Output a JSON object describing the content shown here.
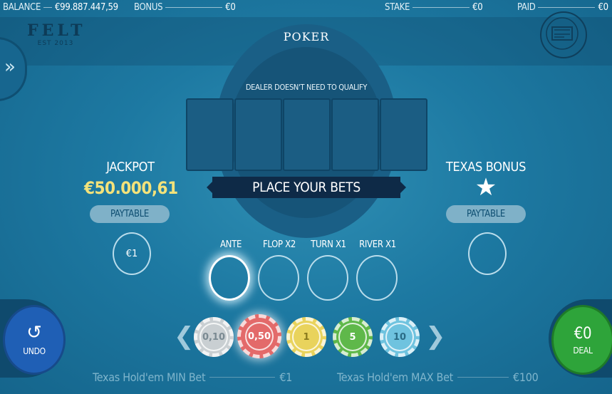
{
  "header": {
    "balance_label": "BALANCE",
    "balance_value": "€99.887.447,59",
    "bonus_label": "BONUS",
    "bonus_value": "€0",
    "stake_label": "STAKE",
    "stake_value": "€0",
    "paid_label": "PAID",
    "paid_value": "€0"
  },
  "logo": {
    "word": "FELT",
    "est": "EST 2013"
  },
  "table": {
    "title": "POKER",
    "qualify_text": "DEALER DOESN'T NEED TO QUALIFY",
    "banner": "PLACE YOUR BETS",
    "card_slots": 5
  },
  "jackpot": {
    "title": "JACKPOT",
    "amount": "€50.000,61",
    "paytable_label": "PAYTABLE",
    "bet_value": "€1"
  },
  "texas_bonus": {
    "title": "TEXAS BONUS",
    "paytable_label": "PAYTABLE"
  },
  "bets": [
    {
      "label": "ANTE",
      "active": true
    },
    {
      "label": "FLOP X2",
      "active": false
    },
    {
      "label": "TURN X1",
      "active": false
    },
    {
      "label": "RIVER X1",
      "active": false
    }
  ],
  "chips": [
    {
      "value": "0,10",
      "color": "#c9cfd2",
      "text_color": "#7a8a92"
    },
    {
      "value": "0,50",
      "color": "#e36a6a",
      "text_color": "#ffffff",
      "selected": true
    },
    {
      "value": "1",
      "color": "#e9d35c",
      "text_color": "#8a7a1e"
    },
    {
      "value": "5",
      "color": "#5fb84a",
      "text_color": "#ffffff"
    },
    {
      "value": "10",
      "color": "#6fc3df",
      "text_color": "#2a6c86"
    }
  ],
  "controls": {
    "undo_label": "UNDO",
    "deal_amount": "€0",
    "deal_label": "DEAL"
  },
  "limits": {
    "min_label": "Texas Hold'em MIN Bet",
    "min_value": "€1",
    "max_label": "Texas Hold'em MAX Bet",
    "max_value": "€100"
  }
}
